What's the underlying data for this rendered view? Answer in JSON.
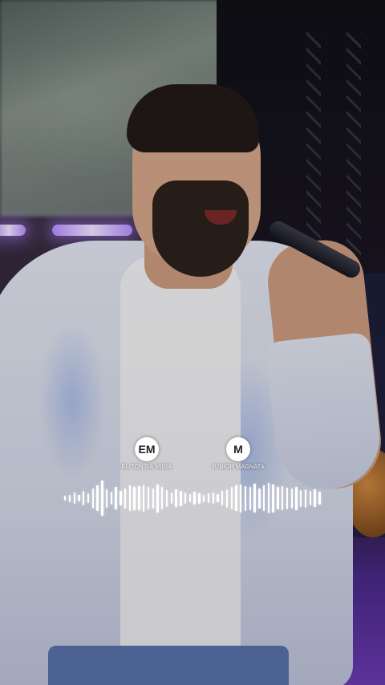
{
  "overlay": {
    "logos": [
      {
        "mark": "EM",
        "label": "ELITON DA MIDIA"
      },
      {
        "mark": "M",
        "label": "JUNIOR MAGNATA"
      }
    ],
    "waveform": {
      "color": "#ffffff",
      "levels": [
        0.12,
        0.2,
        0.3,
        0.18,
        0.4,
        0.26,
        0.55,
        0.7,
        0.95,
        0.5,
        0.35,
        0.6,
        0.4,
        0.55,
        0.7,
        0.62,
        0.66,
        0.72,
        0.6,
        0.55,
        0.75,
        0.6,
        0.45,
        0.3,
        0.48,
        0.42,
        0.3,
        0.22,
        0.35,
        0.28,
        0.2,
        0.26,
        0.3,
        0.22,
        0.4,
        0.5,
        0.6,
        0.7,
        0.75,
        0.68,
        0.62,
        0.78,
        0.55,
        0.7,
        0.82,
        0.75,
        0.6,
        0.66,
        0.58,
        0.55,
        0.62,
        0.45,
        0.5,
        0.4,
        0.48,
        0.35
      ]
    }
  }
}
